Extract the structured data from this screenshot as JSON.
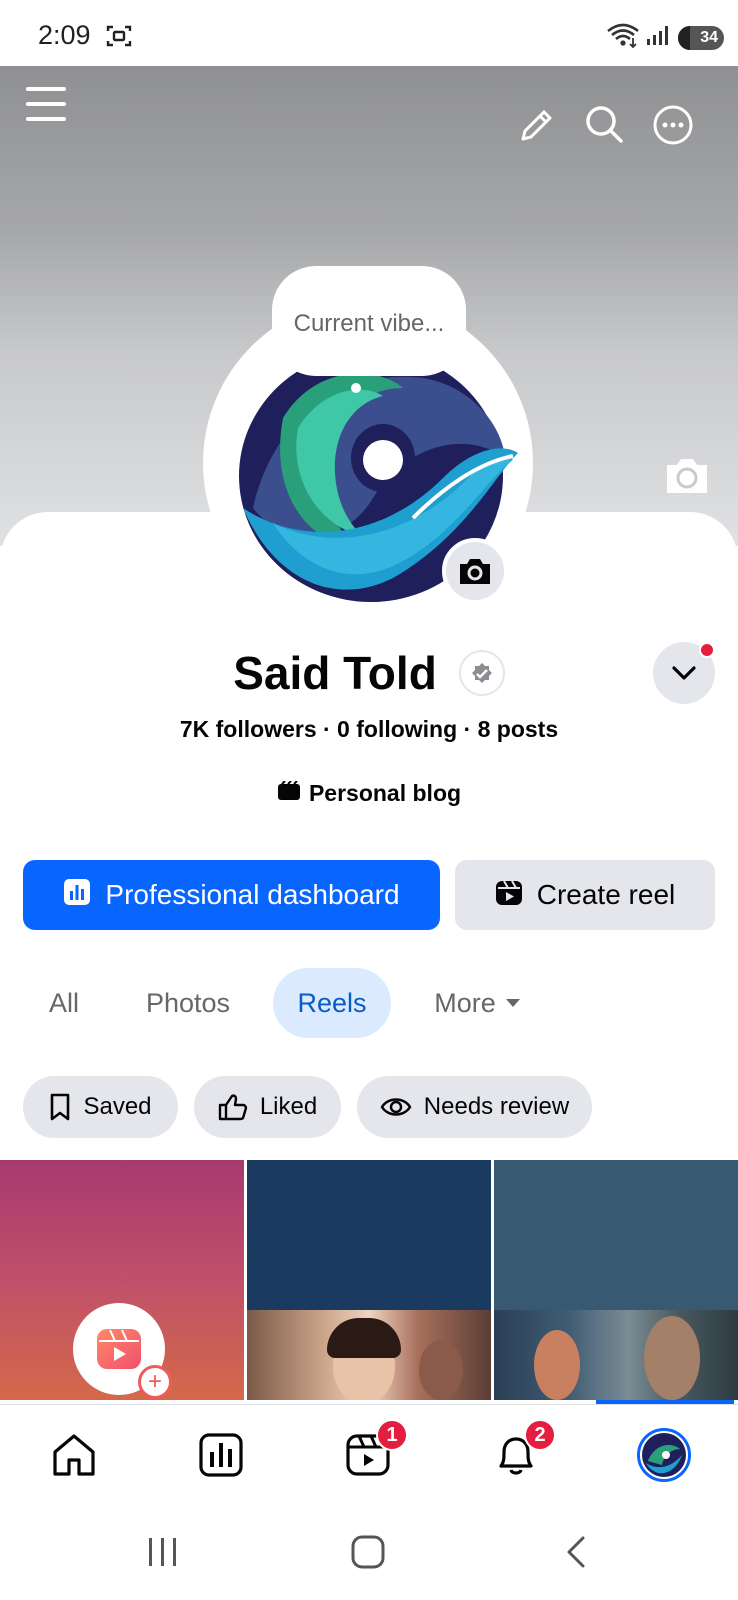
{
  "status_bar": {
    "time": "2:09",
    "battery": "34"
  },
  "profile": {
    "current_vibe_placeholder": "Current vibe...",
    "name": "Said Told",
    "stats": "7K followers · 0 following · 8 posts",
    "category": "Personal blog"
  },
  "actions": {
    "primary_label": "Professional dashboard",
    "secondary_label": "Create reel"
  },
  "tabs": [
    {
      "label": "All",
      "active": false
    },
    {
      "label": "Photos",
      "active": false
    },
    {
      "label": "Reels",
      "active": true
    },
    {
      "label": "More",
      "active": false
    }
  ],
  "filters": [
    {
      "label": "Saved",
      "icon": "bookmark-icon"
    },
    {
      "label": "Liked",
      "icon": "thumbs-up-icon"
    },
    {
      "label": "Needs review",
      "icon": "eye-icon"
    }
  ],
  "bottom_nav": {
    "items": [
      {
        "name": "home",
        "icon": "home-icon"
      },
      {
        "name": "dashboard",
        "icon": "bar-chart-icon"
      },
      {
        "name": "reels",
        "icon": "reels-icon",
        "badge": "1"
      },
      {
        "name": "notifications",
        "icon": "bell-icon",
        "badge": "2"
      },
      {
        "name": "profile",
        "icon": "avatar-icon"
      }
    ]
  },
  "colors": {
    "accent": "#0866ff",
    "badge": "#e41e3f",
    "chip_bg": "#e4e6eb",
    "active_tab_bg": "#dceaff"
  }
}
